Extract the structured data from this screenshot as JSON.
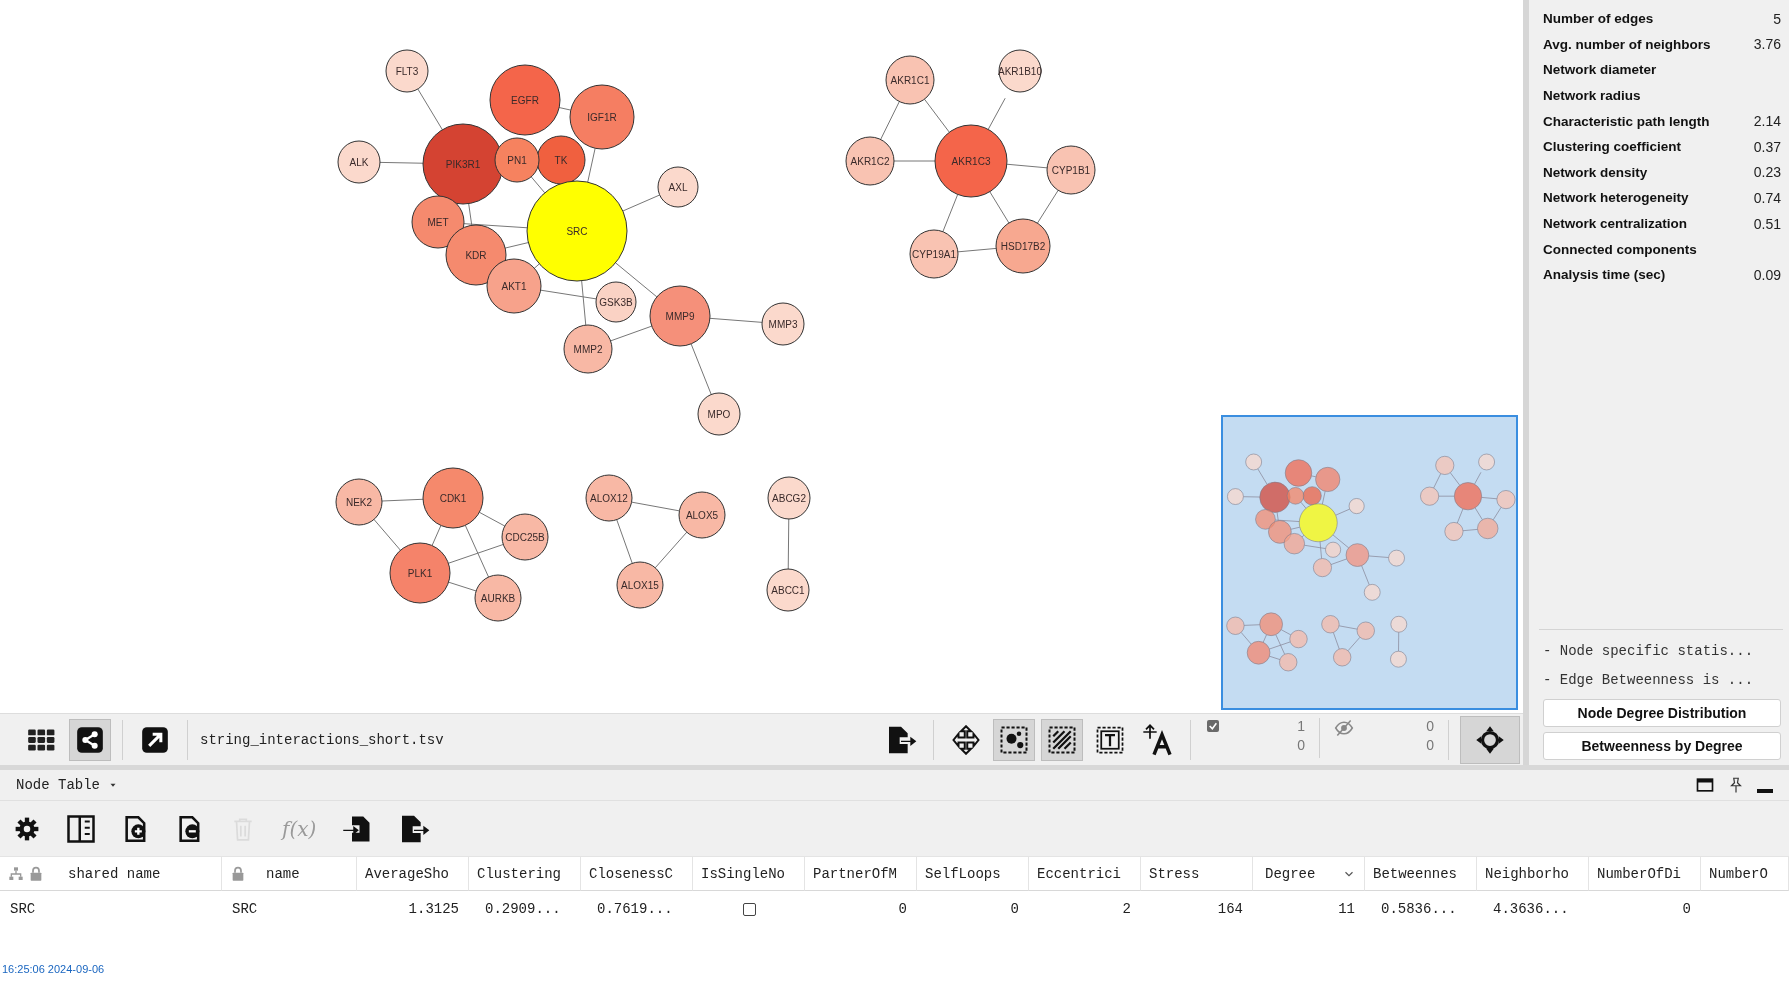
{
  "network": {
    "nodes": [
      {
        "label": "FLT3",
        "color": "#fbd9cc"
      },
      {
        "label": "ALK",
        "color": "#fbd9cc"
      },
      {
        "label": "AXL",
        "color": "#fbd9cc"
      },
      {
        "label": "TK",
        "color": "#f0603f"
      },
      {
        "label": "IGF1R",
        "color": "#f57e62"
      },
      {
        "label": "EGFR",
        "color": "#f4654a"
      },
      {
        "label": "PN1",
        "color": "#f6825f"
      },
      {
        "label": "MET",
        "color": "#f58a6e"
      },
      {
        "label": "KDR",
        "color": "#f58a6e"
      },
      {
        "label": "AKT1",
        "color": "#f7a28b"
      },
      {
        "label": "PIK3R1",
        "color": "#d44332"
      },
      {
        "label": "SRC",
        "color": "#ffff00"
      },
      {
        "label": "GSK3B",
        "color": "#fad2c4"
      },
      {
        "label": "MMP2",
        "color": "#f8b8a5"
      },
      {
        "label": "MMP9",
        "color": "#f5907a"
      },
      {
        "label": "MMP3",
        "color": "#fbd9cc"
      },
      {
        "label": "MPO",
        "color": "#fbd9cc"
      },
      {
        "label": "AKR1C1",
        "color": "#f9c3b2"
      },
      {
        "label": "AKR1B10",
        "color": "#fbd9cc"
      },
      {
        "label": "AKR1C2",
        "color": "#f9c3b2"
      },
      {
        "label": "AKR1C3",
        "color": "#f4654a"
      },
      {
        "label": "CYP1B1",
        "color": "#f9c3b2"
      },
      {
        "label": "CYP19A1",
        "color": "#f9c3b2"
      },
      {
        "label": "HSD17B2",
        "color": "#f7a890"
      },
      {
        "label": "NEK2",
        "color": "#f8b8a5"
      },
      {
        "label": "CDK1",
        "color": "#f5896c"
      },
      {
        "label": "CDC25B",
        "color": "#f8b8a5"
      },
      {
        "label": "PLK1",
        "color": "#f5836a"
      },
      {
        "label": "AURKB",
        "color": "#f8b8a5"
      },
      {
        "label": "ALOX12",
        "color": "#f8b8a5"
      },
      {
        "label": "ALOX5",
        "color": "#f8b8a5"
      },
      {
        "label": "ALOX15",
        "color": "#f8b8a5"
      },
      {
        "label": "ABCG2",
        "color": "#fbd9cc"
      },
      {
        "label": "ABCC1",
        "color": "#fbd9cc"
      }
    ]
  },
  "view_buttons": [
    {
      "kind": "grid",
      "selected": false
    },
    {
      "kind": "share",
      "selected": true
    },
    {
      "kind": "open",
      "selected": false
    }
  ],
  "toolbar": {
    "file_name": "string_interactions_short.tsv",
    "selected_counts": [
      "1",
      "0"
    ],
    "hidden_counts": [
      "0",
      "0"
    ],
    "focus_selected": true
  },
  "canvas_tools": [
    {
      "kind": "export",
      "selected": false
    },
    {
      "kind": "move",
      "selected": false
    },
    {
      "kind": "select-nodes",
      "selected": true
    },
    {
      "kind": "select-edges",
      "selected": true
    },
    {
      "kind": "text-frame",
      "selected": false
    },
    {
      "kind": "font-size",
      "selected": false
    }
  ],
  "statistics": [
    {
      "label": "Number of edges",
      "value": "5"
    },
    {
      "label": "Avg. number of neighbors",
      "value": "3.76"
    },
    {
      "label": "Network diameter"
    },
    {
      "label": "Network radius"
    },
    {
      "label": "Characteristic path length",
      "value": "2.14"
    },
    {
      "label": "Clustering coefficient",
      "value": "0.37"
    },
    {
      "label": "Network density",
      "value": "0.23"
    },
    {
      "label": "Network heterogeneity",
      "value": "0.74"
    },
    {
      "label": "Network centralization",
      "value": "0.51"
    },
    {
      "label": "Connected components"
    },
    {
      "label": "Analysis time (sec)",
      "value": "0.09"
    }
  ],
  "notes": [
    "- Node specific statis...",
    "- Edge Betweenness is ..."
  ],
  "buttons": [
    "Node Degree Distribution",
    "Betweenness by Degree"
  ],
  "table": {
    "title": "Node Table",
    "tools": [
      {
        "kind": "settings",
        "disabled": false
      },
      {
        "kind": "columns",
        "disabled": false
      },
      {
        "kind": "add-row",
        "disabled": false
      },
      {
        "kind": "remove-row",
        "disabled": false
      },
      {
        "kind": "delete",
        "disabled": true
      },
      {
        "kind": "function",
        "label": "f(x)",
        "disabled": true
      },
      {
        "kind": "import",
        "disabled": false
      },
      {
        "kind": "export",
        "disabled": false
      }
    ],
    "columns": [
      {
        "label": "shared name",
        "kind": "shared"
      },
      {
        "label": "name",
        "kind": "locked"
      },
      {
        "label": "AverageSho"
      },
      {
        "label": "Clustering"
      },
      {
        "label": "ClosenessC"
      },
      {
        "label": "IsSingleNo"
      },
      {
        "label": "PartnerOfM"
      },
      {
        "label": "SelfLoops"
      },
      {
        "label": "Eccentrici"
      },
      {
        "label": "Stress"
      },
      {
        "label": "Degree",
        "sorted": true
      },
      {
        "label": "Betweennes"
      },
      {
        "label": "Neighborho"
      },
      {
        "label": "NumberOfDi"
      },
      {
        "label": "NumberO"
      }
    ],
    "rows": [
      {
        "cells": [
          {
            "kind": "text",
            "text": "SRC"
          },
          {
            "kind": "text",
            "text": "SRC"
          },
          {
            "kind": "number",
            "text": "1.3125"
          },
          {
            "kind": "truncated",
            "text": "0.2909..."
          },
          {
            "kind": "truncated",
            "text": "0.7619..."
          },
          {
            "kind": "checkbox",
            "checked": false
          },
          {
            "kind": "number",
            "text": "0"
          },
          {
            "kind": "number",
            "text": "0"
          },
          {
            "kind": "number",
            "text": "2"
          },
          {
            "kind": "number",
            "text": "164"
          },
          {
            "kind": "number",
            "text": "11"
          },
          {
            "kind": "truncated",
            "text": "0.5836..."
          },
          {
            "kind": "truncated",
            "text": "4.3636..."
          },
          {
            "kind": "number",
            "text": "0"
          },
          {
            "kind": "empty"
          }
        ]
      }
    ]
  },
  "status_bar": {
    "timestamp": "16:25:06 2024-09-06"
  }
}
